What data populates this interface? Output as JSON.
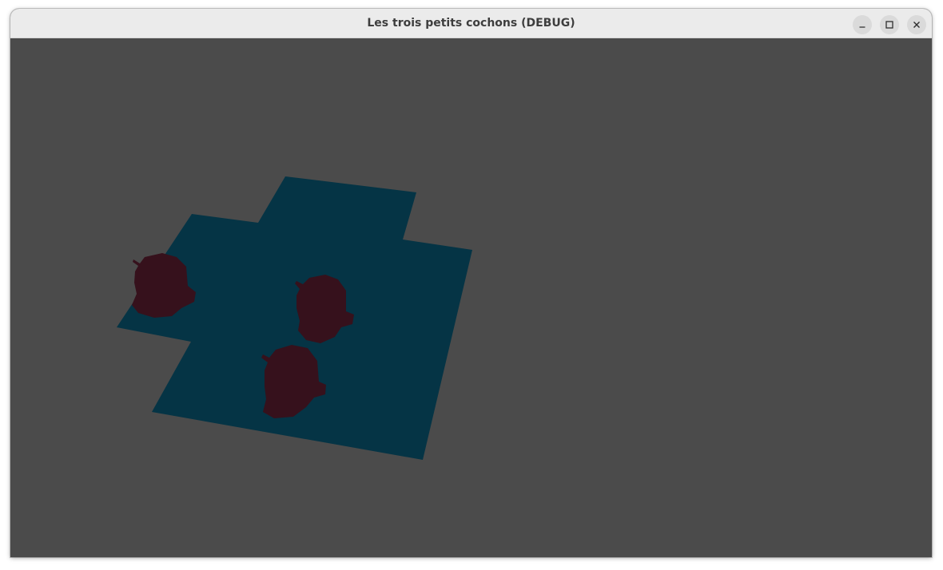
{
  "window": {
    "title": "Les trois petits cochons (DEBUG)",
    "controls": {
      "minimize": "minimize-icon",
      "maximize": "maximize-icon",
      "close": "close-icon"
    }
  },
  "scene": {
    "background_color": "#4b4b4b",
    "ground_color": "#053445",
    "pig_color": "#36111c",
    "pig_count": 3
  }
}
